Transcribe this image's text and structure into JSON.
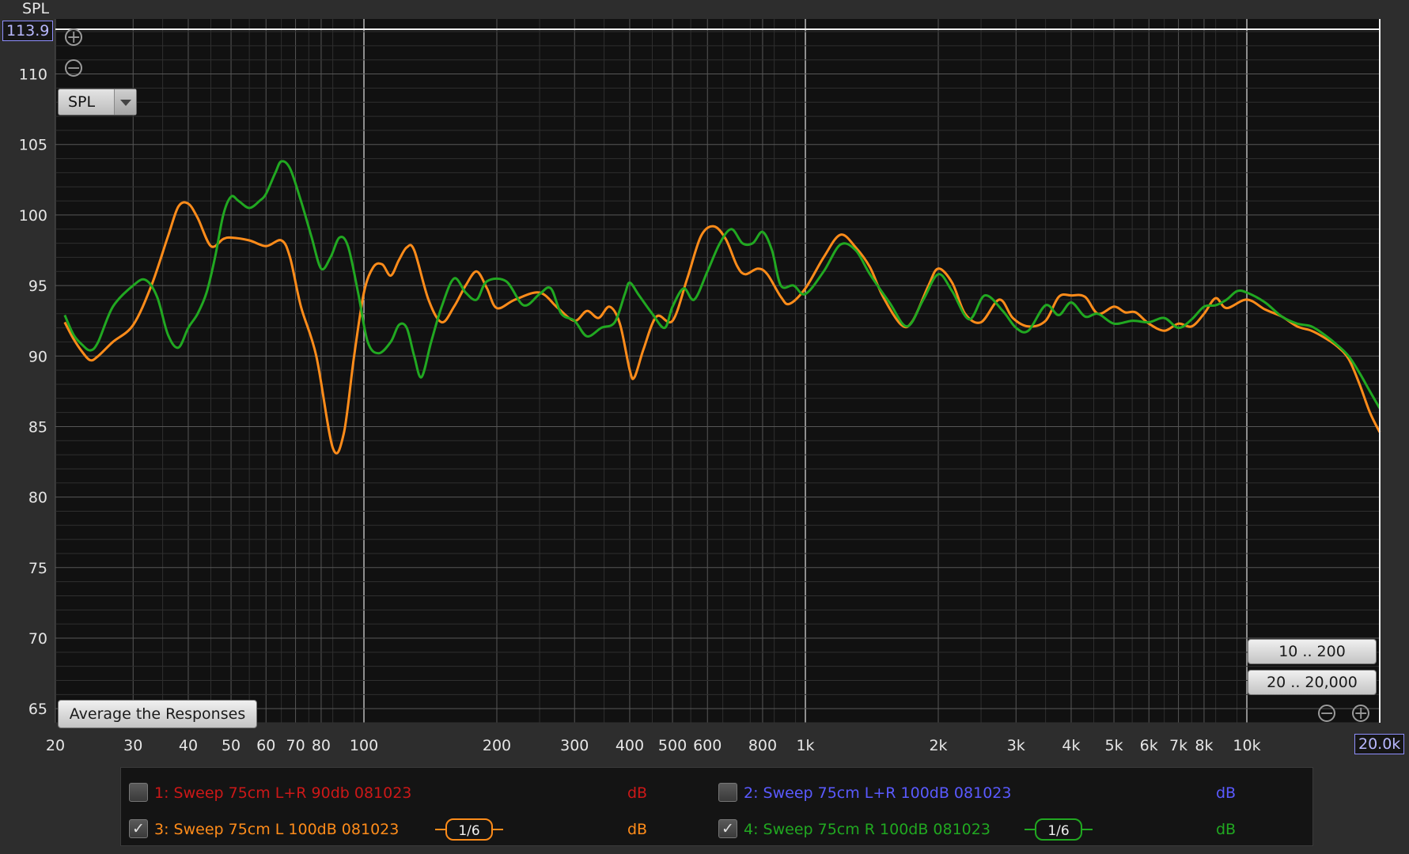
{
  "chart_data": {
    "type": "line",
    "title": "",
    "ylabel": "SPL",
    "xlabel": "",
    "x_scale": "log",
    "xlim": [
      20,
      20000
    ],
    "ylim": [
      64,
      113.9
    ],
    "x_ticks": [
      20,
      30,
      40,
      50,
      60,
      70,
      80,
      100,
      200,
      300,
      400,
      500,
      600,
      800,
      1000,
      2000,
      3000,
      4000,
      5000,
      6000,
      7000,
      8000,
      10000
    ],
    "x_tick_labels": [
      "20",
      "30",
      "40",
      "50",
      "60",
      "70",
      "80",
      "100",
      "200",
      "300",
      "400",
      "500",
      "600",
      "800",
      "1k",
      "2k",
      "3k",
      "4k",
      "5k",
      "6k",
      "7k",
      "8k",
      "10k"
    ],
    "y_ticks": [
      65,
      70,
      75,
      80,
      85,
      90,
      95,
      100,
      105,
      110
    ],
    "y_tick_labels": [
      "65",
      "70",
      "75",
      "80",
      "85",
      "90",
      "95",
      "100",
      "105",
      "110"
    ],
    "grid": true,
    "series": [
      {
        "name": "3: Sweep 75cm L 100dB 081023",
        "color": "#ff8c1a",
        "points": [
          [
            21,
            92.4
          ],
          [
            22,
            91.2
          ],
          [
            23,
            90.3
          ],
          [
            24,
            89.7
          ],
          [
            25,
            90.0
          ],
          [
            27,
            91.0
          ],
          [
            30,
            92.2
          ],
          [
            33,
            95.0
          ],
          [
            36,
            98.5
          ],
          [
            38,
            100.6
          ],
          [
            40,
            100.8
          ],
          [
            42,
            99.8
          ],
          [
            45,
            97.8
          ],
          [
            48,
            98.3
          ],
          [
            50,
            98.4
          ],
          [
            55,
            98.2
          ],
          [
            60,
            97.8
          ],
          [
            65,
            98.2
          ],
          [
            68,
            97.0
          ],
          [
            72,
            93.5
          ],
          [
            78,
            90.0
          ],
          [
            85,
            83.5
          ],
          [
            90,
            84.5
          ],
          [
            95,
            90.0
          ],
          [
            100,
            94.5
          ],
          [
            105,
            96.3
          ],
          [
            110,
            96.5
          ],
          [
            115,
            95.7
          ],
          [
            120,
            96.8
          ],
          [
            125,
            97.7
          ],
          [
            130,
            97.5
          ],
          [
            140,
            94.0
          ],
          [
            150,
            92.4
          ],
          [
            160,
            93.5
          ],
          [
            170,
            95.0
          ],
          [
            180,
            96.0
          ],
          [
            190,
            94.8
          ],
          [
            200,
            93.4
          ],
          [
            220,
            94.0
          ],
          [
            250,
            94.5
          ],
          [
            275,
            93.4
          ],
          [
            300,
            92.5
          ],
          [
            320,
            93.2
          ],
          [
            340,
            92.7
          ],
          [
            360,
            93.5
          ],
          [
            380,
            92.3
          ],
          [
            400,
            89.0
          ],
          [
            410,
            88.5
          ],
          [
            430,
            90.5
          ],
          [
            460,
            92.8
          ],
          [
            500,
            92.5
          ],
          [
            540,
            95.5
          ],
          [
            580,
            98.5
          ],
          [
            620,
            99.2
          ],
          [
            660,
            98.3
          ],
          [
            700,
            96.4
          ],
          [
            730,
            95.8
          ],
          [
            780,
            96.2
          ],
          [
            820,
            95.8
          ],
          [
            880,
            94.2
          ],
          [
            920,
            93.7
          ],
          [
            1000,
            94.8
          ],
          [
            1100,
            97.0
          ],
          [
            1200,
            98.6
          ],
          [
            1300,
            97.7
          ],
          [
            1400,
            96.3
          ],
          [
            1500,
            94.2
          ],
          [
            1650,
            92.2
          ],
          [
            1750,
            92.5
          ],
          [
            1900,
            95.0
          ],
          [
            2000,
            96.2
          ],
          [
            2150,
            95.2
          ],
          [
            2300,
            93.0
          ],
          [
            2500,
            92.4
          ],
          [
            2750,
            94.0
          ],
          [
            2950,
            92.7
          ],
          [
            3200,
            92.1
          ],
          [
            3500,
            92.5
          ],
          [
            3750,
            94.2
          ],
          [
            4000,
            94.3
          ],
          [
            4300,
            94.2
          ],
          [
            4600,
            93.0
          ],
          [
            5000,
            93.5
          ],
          [
            5300,
            93.1
          ],
          [
            5600,
            93.1
          ],
          [
            6000,
            92.3
          ],
          [
            6500,
            91.8
          ],
          [
            7000,
            92.3
          ],
          [
            7500,
            92.1
          ],
          [
            8000,
            93.0
          ],
          [
            8500,
            94.1
          ],
          [
            9000,
            93.4
          ],
          [
            10000,
            94.0
          ],
          [
            11000,
            93.3
          ],
          [
            12000,
            92.8
          ],
          [
            13000,
            92.1
          ],
          [
            14000,
            91.8
          ],
          [
            15000,
            91.3
          ],
          [
            16000,
            90.7
          ],
          [
            17000,
            89.8
          ],
          [
            18000,
            88.0
          ],
          [
            19000,
            86.0
          ],
          [
            20000,
            84.6
          ]
        ]
      },
      {
        "name": "4: Sweep 75cm R 100dB 081023",
        "color": "#21a821",
        "points": [
          [
            21,
            92.9
          ],
          [
            22,
            91.5
          ],
          [
            23,
            90.8
          ],
          [
            24,
            90.4
          ],
          [
            25,
            91.0
          ],
          [
            27,
            93.5
          ],
          [
            30,
            95.0
          ],
          [
            32,
            95.4
          ],
          [
            34,
            94.2
          ],
          [
            36,
            91.5
          ],
          [
            38,
            90.6
          ],
          [
            40,
            92.0
          ],
          [
            42,
            93.0
          ],
          [
            44,
            94.5
          ],
          [
            46,
            97.0
          ],
          [
            48,
            100.0
          ],
          [
            50,
            101.3
          ],
          [
            52,
            101.0
          ],
          [
            55,
            100.5
          ],
          [
            58,
            101.0
          ],
          [
            60,
            101.5
          ],
          [
            63,
            103.0
          ],
          [
            65,
            103.8
          ],
          [
            68,
            103.3
          ],
          [
            72,
            101.0
          ],
          [
            76,
            98.5
          ],
          [
            80,
            96.2
          ],
          [
            84,
            97.0
          ],
          [
            88,
            98.4
          ],
          [
            92,
            97.8
          ],
          [
            97,
            94.5
          ],
          [
            102,
            91.0
          ],
          [
            108,
            90.2
          ],
          [
            115,
            91.0
          ],
          [
            120,
            92.2
          ],
          [
            125,
            92.0
          ],
          [
            130,
            90.0
          ],
          [
            135,
            88.5
          ],
          [
            142,
            91.0
          ],
          [
            150,
            93.5
          ],
          [
            160,
            95.5
          ],
          [
            170,
            94.5
          ],
          [
            180,
            94.0
          ],
          [
            190,
            95.3
          ],
          [
            210,
            95.3
          ],
          [
            230,
            93.6
          ],
          [
            250,
            94.4
          ],
          [
            265,
            94.8
          ],
          [
            280,
            93.0
          ],
          [
            300,
            92.5
          ],
          [
            320,
            91.4
          ],
          [
            345,
            92.0
          ],
          [
            370,
            92.4
          ],
          [
            390,
            94.4
          ],
          [
            400,
            95.2
          ],
          [
            420,
            94.3
          ],
          [
            450,
            93.0
          ],
          [
            480,
            92.0
          ],
          [
            500,
            93.5
          ],
          [
            530,
            94.8
          ],
          [
            560,
            94.0
          ],
          [
            600,
            96.0
          ],
          [
            640,
            98.0
          ],
          [
            680,
            99.0
          ],
          [
            720,
            98.0
          ],
          [
            760,
            98.0
          ],
          [
            800,
            98.8
          ],
          [
            840,
            97.5
          ],
          [
            880,
            95.0
          ],
          [
            940,
            95.0
          ],
          [
            1000,
            94.4
          ],
          [
            1100,
            96.0
          ],
          [
            1200,
            97.9
          ],
          [
            1300,
            97.5
          ],
          [
            1400,
            95.8
          ],
          [
            1550,
            93.8
          ],
          [
            1700,
            92.1
          ],
          [
            1850,
            94.0
          ],
          [
            2000,
            95.8
          ],
          [
            2150,
            94.6
          ],
          [
            2350,
            92.6
          ],
          [
            2550,
            94.3
          ],
          [
            2800,
            93.2
          ],
          [
            3000,
            92.0
          ],
          [
            3200,
            91.8
          ],
          [
            3500,
            93.6
          ],
          [
            3750,
            92.9
          ],
          [
            4000,
            93.8
          ],
          [
            4300,
            92.8
          ],
          [
            4600,
            93.0
          ],
          [
            5000,
            92.3
          ],
          [
            5500,
            92.5
          ],
          [
            6000,
            92.4
          ],
          [
            6500,
            92.7
          ],
          [
            7000,
            92.0
          ],
          [
            7500,
            92.6
          ],
          [
            8000,
            93.5
          ],
          [
            8500,
            93.6
          ],
          [
            9000,
            94.0
          ],
          [
            9500,
            94.6
          ],
          [
            10000,
            94.5
          ],
          [
            11000,
            93.8
          ],
          [
            12000,
            92.8
          ],
          [
            13000,
            92.3
          ],
          [
            14000,
            92.1
          ],
          [
            15000,
            91.5
          ],
          [
            16000,
            90.8
          ],
          [
            17000,
            90.0
          ],
          [
            18000,
            88.8
          ],
          [
            19000,
            87.5
          ],
          [
            20000,
            86.3
          ]
        ]
      }
    ]
  },
  "y_readout": "113.9",
  "x_readout": "20.0k",
  "spl_select": "SPL",
  "avg_button": "Average the Responses",
  "range_buttons": [
    "10 .. 200",
    "20 .. 20,000"
  ],
  "legend": {
    "items": [
      {
        "label": "1: Sweep 75cm L+R 90db 081023",
        "unit": "dB",
        "checked": false,
        "color": "#cc1818",
        "smoothing": null
      },
      {
        "label": "2: Sweep 75cm L+R 100dB 081023",
        "unit": "dB",
        "checked": false,
        "color": "#5a5aff",
        "smoothing": null
      },
      {
        "label": "3: Sweep 75cm L 100dB 081023",
        "unit": "dB",
        "checked": true,
        "color": "#ff8c1a",
        "smoothing": "1/6"
      },
      {
        "label": "4: Sweep 75cm R 100dB 081023",
        "unit": "dB",
        "checked": true,
        "color": "#21a821",
        "smoothing": "1/6"
      }
    ],
    "check_mark": "✓"
  },
  "icons": {
    "zoom_in": "zoom-in-icon",
    "zoom_out": "zoom-out-icon"
  },
  "colors": {
    "plot_bg": "#111111",
    "grid_major": "#575757",
    "grid_minor": "#2f2f2f",
    "axis_text": "#e6e6e6"
  }
}
